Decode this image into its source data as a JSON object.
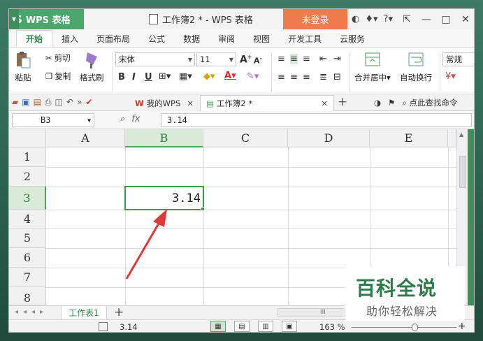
{
  "app": {
    "name": "WPS 表格",
    "login_label": "未登录",
    "help_label": "?"
  },
  "window": {
    "doc_title": "工作簿2 * - WPS 表格"
  },
  "menu_tabs": [
    "开始",
    "插入",
    "页面布局",
    "公式",
    "数据",
    "审阅",
    "视图",
    "开发工具",
    "云服务"
  ],
  "ribbon": {
    "paste": "粘贴",
    "cut": "剪切",
    "copy": "复制",
    "format_painter": "格式刷",
    "font_name": "宋体",
    "font_size": "11",
    "bold": "B",
    "italic": "I",
    "underline": "U",
    "font_grow": "A",
    "font_shrink": "A",
    "font_color": "A",
    "merge_center": "合并居中",
    "wrap_text": "自动换行",
    "number_format": "常规"
  },
  "doc_tabs": [
    {
      "label": "我的WPS",
      "icon": "W"
    },
    {
      "label": "工作簿2 *"
    }
  ],
  "search_label": "点此查找命令",
  "formula_bar": {
    "cell_ref": "B3",
    "fx": "fx",
    "value": "3.14"
  },
  "columns": [
    "A",
    "B",
    "C",
    "D",
    "E"
  ],
  "rows": [
    "1",
    "2",
    "3",
    "4",
    "5",
    "6",
    "7",
    "8"
  ],
  "selected": {
    "column": "B",
    "row": "3",
    "value": "3.14"
  },
  "sheet": {
    "tab": "工作表1",
    "add": "+",
    "scroll_grip": "III"
  },
  "status": {
    "value": "3.14",
    "zoom": "163 %",
    "zoom_plus": "+"
  },
  "watermark": {
    "line1": "百科全说",
    "line2": "助你轻松解决"
  },
  "colors": {
    "accent_green": "#4aa66a",
    "login_orange": "#ef7a4c",
    "selection_green": "#3f9a4f",
    "arrow_red": "#e0393a"
  }
}
